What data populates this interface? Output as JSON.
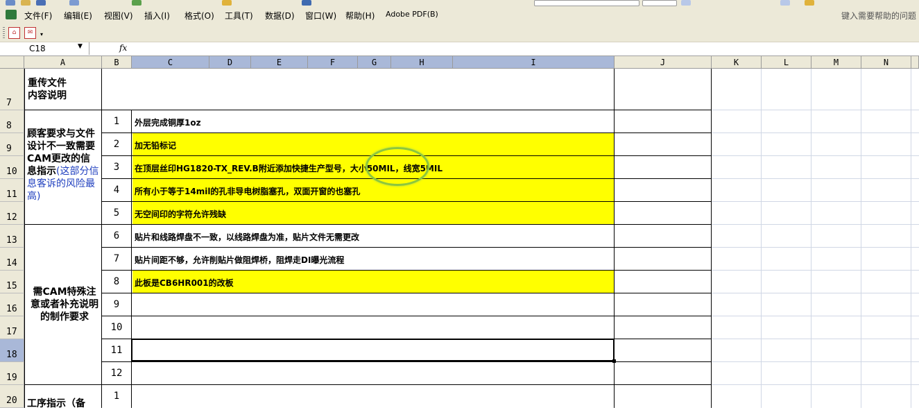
{
  "menubar": {
    "items": [
      "文件(F)",
      "编辑(E)",
      "视图(V)",
      "插入(I)",
      "格式(O)",
      "工具(T)",
      "数据(D)",
      "窗口(W)",
      "帮助(H)",
      "Adobe PDF(B)"
    ],
    "help_placeholder": "键入需要帮助的问题"
  },
  "formula_bar": {
    "cell_ref": "C18",
    "fx": "fx",
    "dropdown": "▼"
  },
  "columns": [
    "A",
    "B",
    "C",
    "D",
    "E",
    "F",
    "G",
    "H",
    "I",
    "J",
    "K",
    "L",
    "M",
    "N"
  ],
  "rows": [
    "7",
    "8",
    "9",
    "10",
    "11",
    "12",
    "13",
    "14",
    "15",
    "16",
    "17",
    "18",
    "19",
    "20"
  ],
  "sheet": {
    "label_reupload": "重传文件\n内容说明",
    "label_customer_main": "顾客要求与文件设计不一致需要CAM更改的信息指示",
    "label_customer_note": "(这部分信息客诉的风险最高)",
    "label_cam_special": "需CAM特殊注意或者补充说明的制作要求",
    "label_process": "工序指示（备",
    "items": [
      {
        "no": "1",
        "text": "外层完成铜厚1oz",
        "highlight": false
      },
      {
        "no": "2",
        "text": "加无铅标记",
        "highlight": true
      },
      {
        "no": "3",
        "text": "在顶层丝印HG1820-TX_REV.B附近添加快捷生产型号，大小50MIL，线宽5MIL",
        "highlight": true
      },
      {
        "no": "4",
        "text": "所有小于等于14mil的孔非导电树脂塞孔，双面开窗的也塞孔",
        "highlight": true
      },
      {
        "no": "5",
        "text": "无空间印的字符允许残缺",
        "highlight": true
      },
      {
        "no": "6",
        "text": "贴片和线路焊盘不一致，以线路焊盘为准，贴片文件无需更改",
        "highlight": false
      },
      {
        "no": "7",
        "text": "贴片间距不够，允许削贴片做阻焊桥，阻焊走DI曝光流程",
        "highlight": false
      },
      {
        "no": "8",
        "text": "此板是CB6HR001的改板",
        "highlight": true
      },
      {
        "no": "9",
        "text": "",
        "highlight": false
      },
      {
        "no": "10",
        "text": "",
        "highlight": false
      },
      {
        "no": "11",
        "text": "",
        "highlight": false
      },
      {
        "no": "12",
        "text": "",
        "highlight": false
      }
    ],
    "process_first_no": "1"
  },
  "colors": {
    "highlight": "#ffff00",
    "annotation_circle": "#8cc63f",
    "selected_header": "#a9b8d8"
  }
}
